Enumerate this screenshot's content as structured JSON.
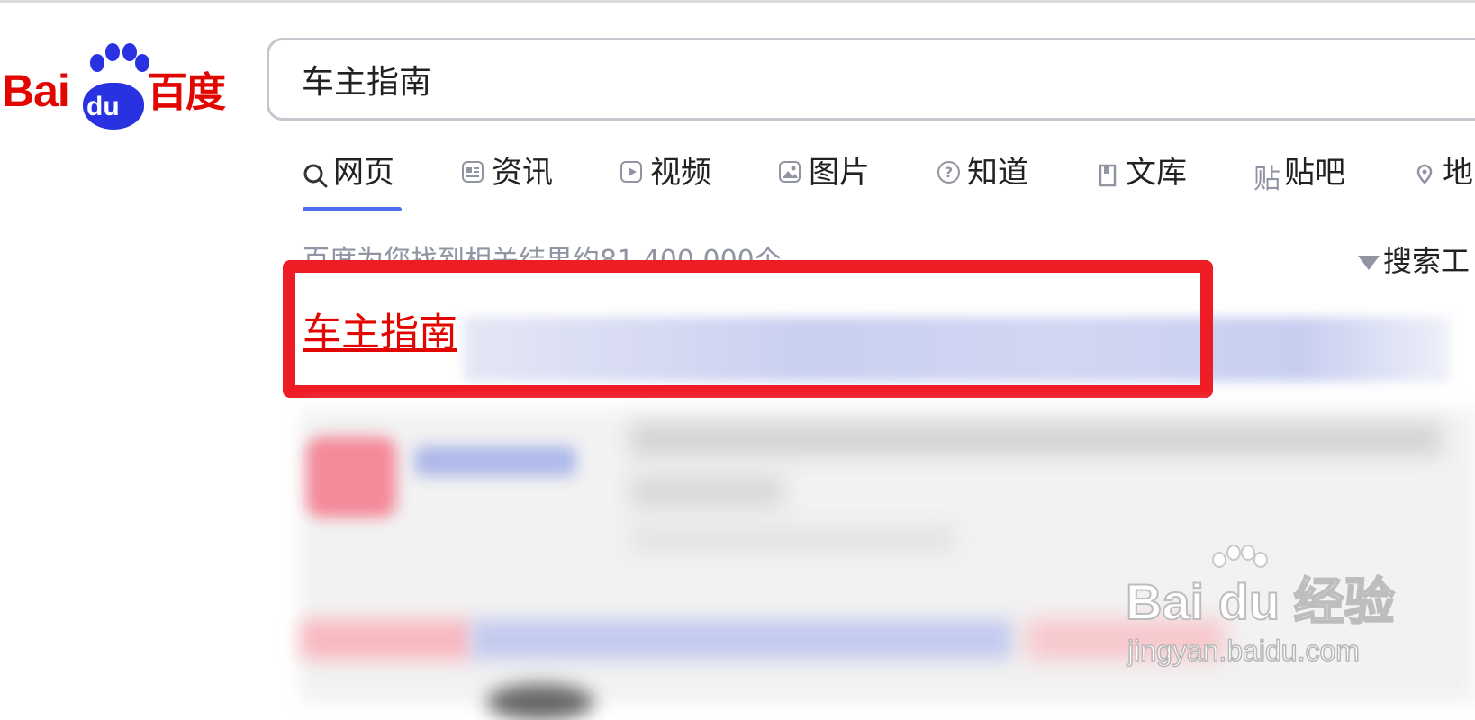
{
  "logo": {
    "text_latin": "Bai",
    "text_paw": "du",
    "text_cn": "百度"
  },
  "search": {
    "query": "车主指南"
  },
  "tabs": [
    {
      "label": "网页",
      "icon": "search-icon",
      "active": true
    },
    {
      "label": "资讯",
      "icon": "news-icon",
      "active": false
    },
    {
      "label": "视频",
      "icon": "video-icon",
      "active": false
    },
    {
      "label": "图片",
      "icon": "image-icon",
      "active": false
    },
    {
      "label": "知道",
      "icon": "question-icon",
      "active": false
    },
    {
      "label": "文库",
      "icon": "document-icon",
      "active": false
    },
    {
      "label": "贴吧",
      "icon": "tieba-icon",
      "active": false
    },
    {
      "label": "地",
      "icon": "map-icon",
      "active": false
    }
  ],
  "results": {
    "count_text": "百度为您找到相关结果约81,400,000个",
    "tools_label": "搜索工",
    "first_title": "车主指南"
  },
  "watermark": {
    "brand": "Bai du 经验",
    "url": "jingyan.baidu.com"
  },
  "colors": {
    "brand_red": "#e10601",
    "brand_blue": "#2932e1",
    "tab_accent": "#4e6ef2",
    "highlight": "#ee1c25"
  }
}
